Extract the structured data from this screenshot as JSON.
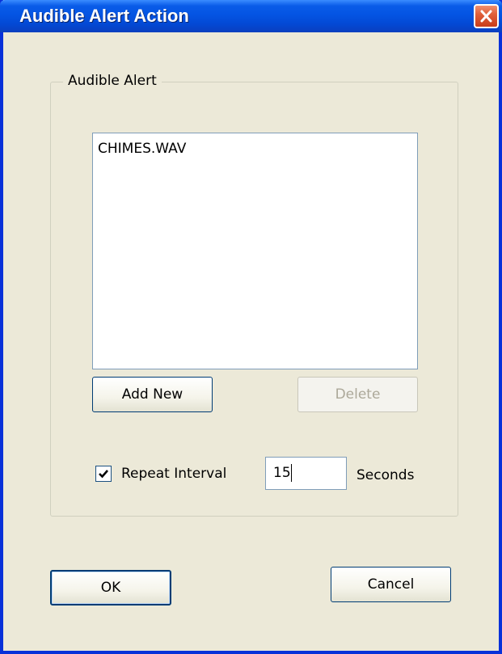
{
  "window": {
    "title": "Audible Alert Action",
    "close_icon": "close-x-icon"
  },
  "group": {
    "label": "Audible Alert",
    "list_items": [
      "CHIMES.WAV"
    ],
    "add_new_label": "Add New",
    "delete_label": "Delete",
    "delete_enabled": false,
    "repeat_checked": true,
    "repeat_label": "Repeat Interval",
    "interval_value": "15",
    "seconds_label": "Seconds"
  },
  "footer": {
    "ok_label": "OK",
    "cancel_label": "Cancel"
  },
  "colors": {
    "titlebar": "#0454e3",
    "face": "#ece9d8",
    "close_button": "#e0603a",
    "border_blue": "#0831d9",
    "disabled_text": "#aca899"
  }
}
